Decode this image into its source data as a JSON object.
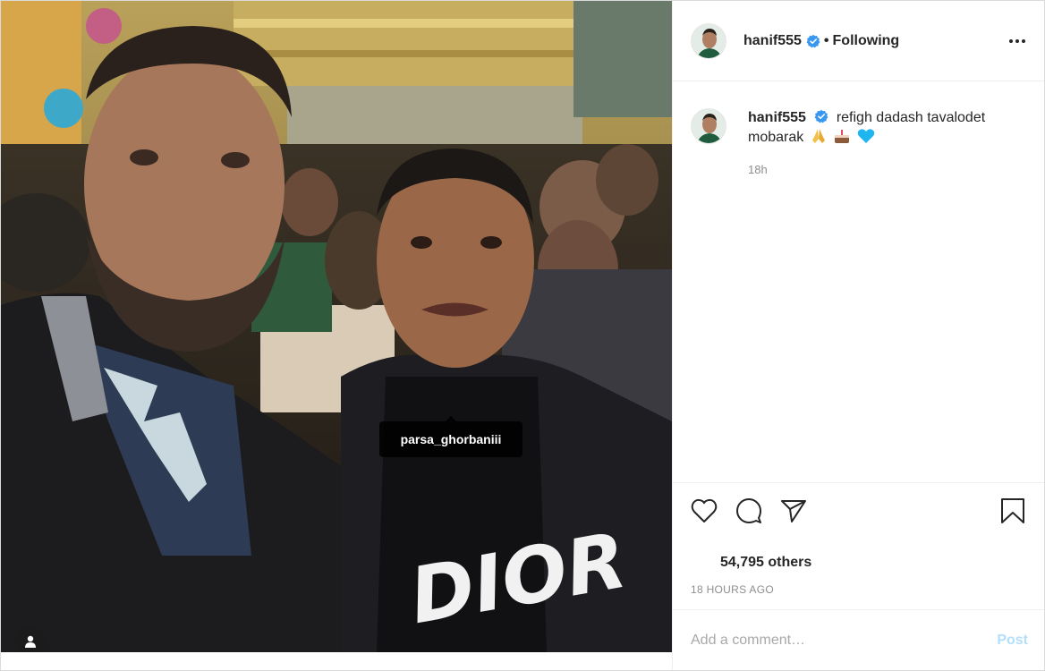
{
  "post": {
    "photo": {
      "tag_label": "parsa_ghorbaniii",
      "shirt_text": "DIOR",
      "tags_icon": "user-icon"
    },
    "header": {
      "username": "hanif555",
      "verified_icon": "verified-badge-icon",
      "separator": "•",
      "follow_status": "Following",
      "more_icon": "more-options-icon"
    },
    "caption": {
      "username": "hanif555",
      "text": "refigh dadash tavalodet mobarak",
      "emojis": [
        "folded-hands",
        "cake",
        "blue-heart"
      ],
      "time": "18h"
    },
    "actions": {
      "like_icon": "heart-icon",
      "comment_icon": "comment-icon",
      "share_icon": "share-icon",
      "save_icon": "bookmark-icon"
    },
    "likes_text": "54,795 others",
    "posted_time": "18 HOURS AGO",
    "comment": {
      "placeholder": "Add a comment…",
      "post_label": "Post"
    },
    "colors": {
      "verified": "#3897f0",
      "post_button_disabled": "#b2dffc",
      "muted_text": "#8e8e8e"
    }
  }
}
